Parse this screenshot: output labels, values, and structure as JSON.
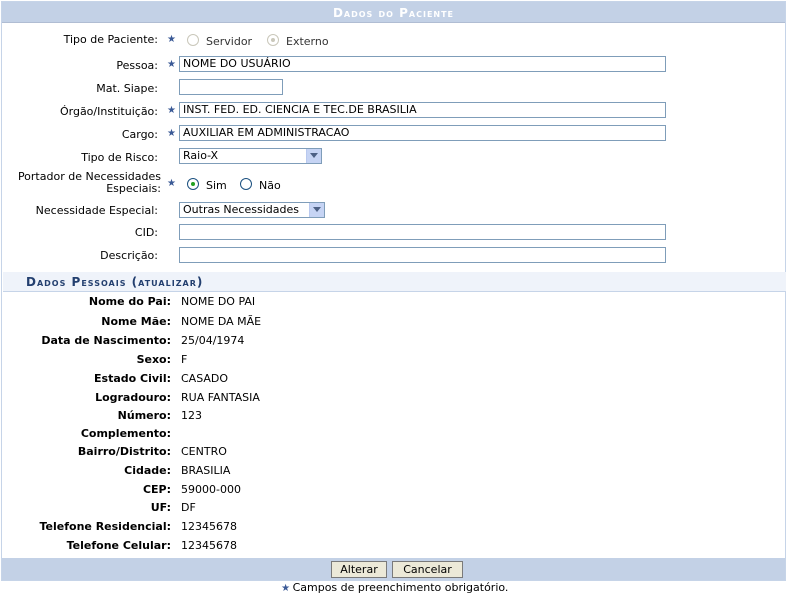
{
  "panel": {
    "title": "Dados do Paciente"
  },
  "form": {
    "tipo_paciente": {
      "label": "Tipo de Paciente:",
      "options": [
        "Servidor",
        "Externo"
      ],
      "selected": "Externo"
    },
    "pessoa": {
      "label": "Pessoa:",
      "value": "NOME DO USUÁRIO"
    },
    "mat_siape": {
      "label": "Mat. Siape:",
      "value": ""
    },
    "orgao": {
      "label": "Órgão/Instituição:",
      "value": "INST. FED. ED. CIENCIA E TEC.DE BRASILIA"
    },
    "cargo": {
      "label": "Cargo:",
      "value": "AUXILIAR EM ADMINISTRACAO"
    },
    "tipo_risco": {
      "label": "Tipo de Risco:",
      "selected": "Raio-X"
    },
    "portador": {
      "label_line1": "Portador de Necessidades",
      "label_line2": "Especiais:",
      "options": [
        "Sim",
        "Não"
      ],
      "selected": "Sim"
    },
    "necessidade": {
      "label": "Necessidade Especial:",
      "selected": "Outras Necessidades"
    },
    "cid": {
      "label": "CID:",
      "value": ""
    },
    "descricao": {
      "label": "Descrição:",
      "value": ""
    }
  },
  "dados_pessoais": {
    "title": "Dados Pessoais",
    "link": "(atualizar)",
    "fields": [
      {
        "label": "Nome do Pai:",
        "value": "NOME DO PAI"
      },
      {
        "label": "Nome Mãe:",
        "value": "NOME DA MÃE"
      },
      {
        "label": "Data de Nascimento:",
        "value": "25/04/1974"
      },
      {
        "label": "Sexo:",
        "value": "F"
      },
      {
        "label": "Estado Civil:",
        "value": "CASADO"
      },
      {
        "label": "Logradouro:",
        "value": "RUA FANTASIA"
      },
      {
        "label": "Número:",
        "value": "123"
      },
      {
        "label": "Complemento:",
        "value": ""
      },
      {
        "label": "Bairro/Distrito:",
        "value": "CENTRO"
      },
      {
        "label": "Cidade:",
        "value": "BRASILIA"
      },
      {
        "label": "CEP:",
        "value": "59000-000"
      },
      {
        "label": "UF:",
        "value": "DF"
      },
      {
        "label": "Telefone Residencial:",
        "value": "12345678"
      },
      {
        "label": "Telefone Celular:",
        "value": "12345678"
      }
    ]
  },
  "buttons": {
    "alterar": "Alterar",
    "cancelar": "Cancelar"
  },
  "note": "Campos de preenchimento obrigatório.",
  "colors": {
    "caption_bg": "#c3d1e6",
    "star": "#3b5a96",
    "heading": "#233f6f"
  },
  "icons": {
    "required": "star-icon",
    "dropdown": "chevron-down-icon"
  }
}
